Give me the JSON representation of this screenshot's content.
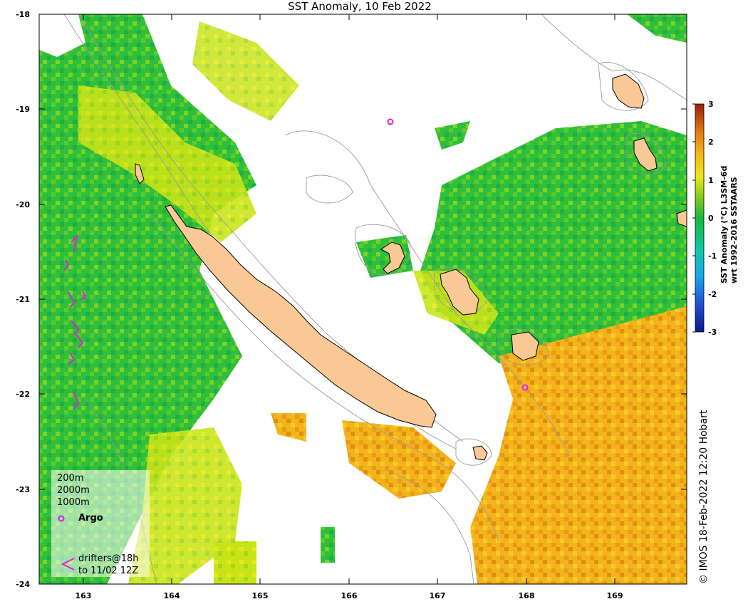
{
  "title": "SST Anomaly, 10 Feb 2022",
  "axes": {
    "lon_ticks": [
      "163",
      "164",
      "165",
      "166",
      "167",
      "168",
      "169"
    ],
    "lat_ticks": [
      "-18",
      "-19",
      "-20",
      "-21",
      "-22",
      "-23",
      "-24"
    ],
    "lon_range": [
      162.5,
      169.8
    ],
    "lat_range": [
      -24,
      -18
    ]
  },
  "colorbar": {
    "label_line1": "SST Anomaly (°C) L3SM-6d",
    "label_line2": "wrt 1992-2016 SSTAARS",
    "ticks": [
      "3",
      "2",
      "1",
      "0",
      "-1",
      "-2",
      "-3"
    ],
    "range": [
      -3,
      3
    ]
  },
  "legend": {
    "contour_200": "200m",
    "contour_2000": "2000m",
    "contour_1000": "1000m",
    "argo_label": "Argo",
    "drifters_line1": "drifters@18h",
    "drifters_line2": "to 11/02 12Z"
  },
  "copyright": "© IMOS 18-Feb-2022 12:20 Hobart",
  "colors": {
    "land": "#f9c894",
    "argo_marker": "#e020e0",
    "drifter": "#e020e0",
    "cool": "#22b832",
    "neutral": "#b8e018",
    "warm": "#f0a818"
  },
  "argo_floats": [
    {
      "lon": 166.47,
      "lat": -19.13
    },
    {
      "lon": 167.99,
      "lat": -21.93
    }
  ]
}
